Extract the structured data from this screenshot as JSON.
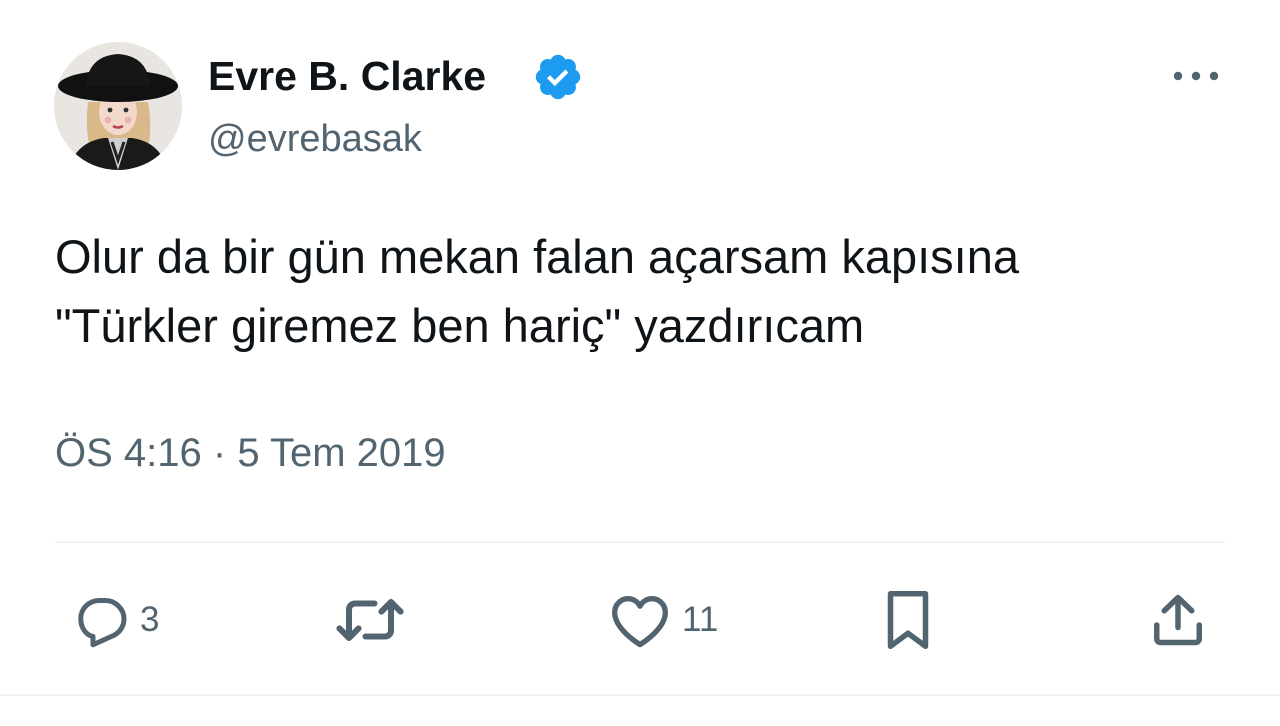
{
  "tweet": {
    "author": {
      "display_name": "Evre B. Clarke",
      "handle": "@evrebasak",
      "verified": true,
      "verified_color": "#1d9bf0",
      "avatar_icon": "profile-photo-woman-black-hat"
    },
    "text_lines": [
      "Olur da bir gün mekan falan açarsam kapısına",
      "\"Türkler giremez ben hariç\" yazdırıcam"
    ],
    "time": "ÖS 4:16",
    "separator": "·",
    "date": "5 Tem 2019",
    "more_icon": "ellipsis-icon"
  },
  "actions": {
    "reply": {
      "icon": "reply-icon",
      "count": "3"
    },
    "retweet": {
      "icon": "retweet-icon",
      "count": ""
    },
    "like": {
      "icon": "heart-icon",
      "count": "11"
    },
    "bookmark": {
      "icon": "bookmark-icon"
    },
    "share": {
      "icon": "share-icon"
    }
  },
  "colors": {
    "text_primary": "#0f1419",
    "text_secondary": "#536471",
    "divider": "#eff3f4"
  }
}
